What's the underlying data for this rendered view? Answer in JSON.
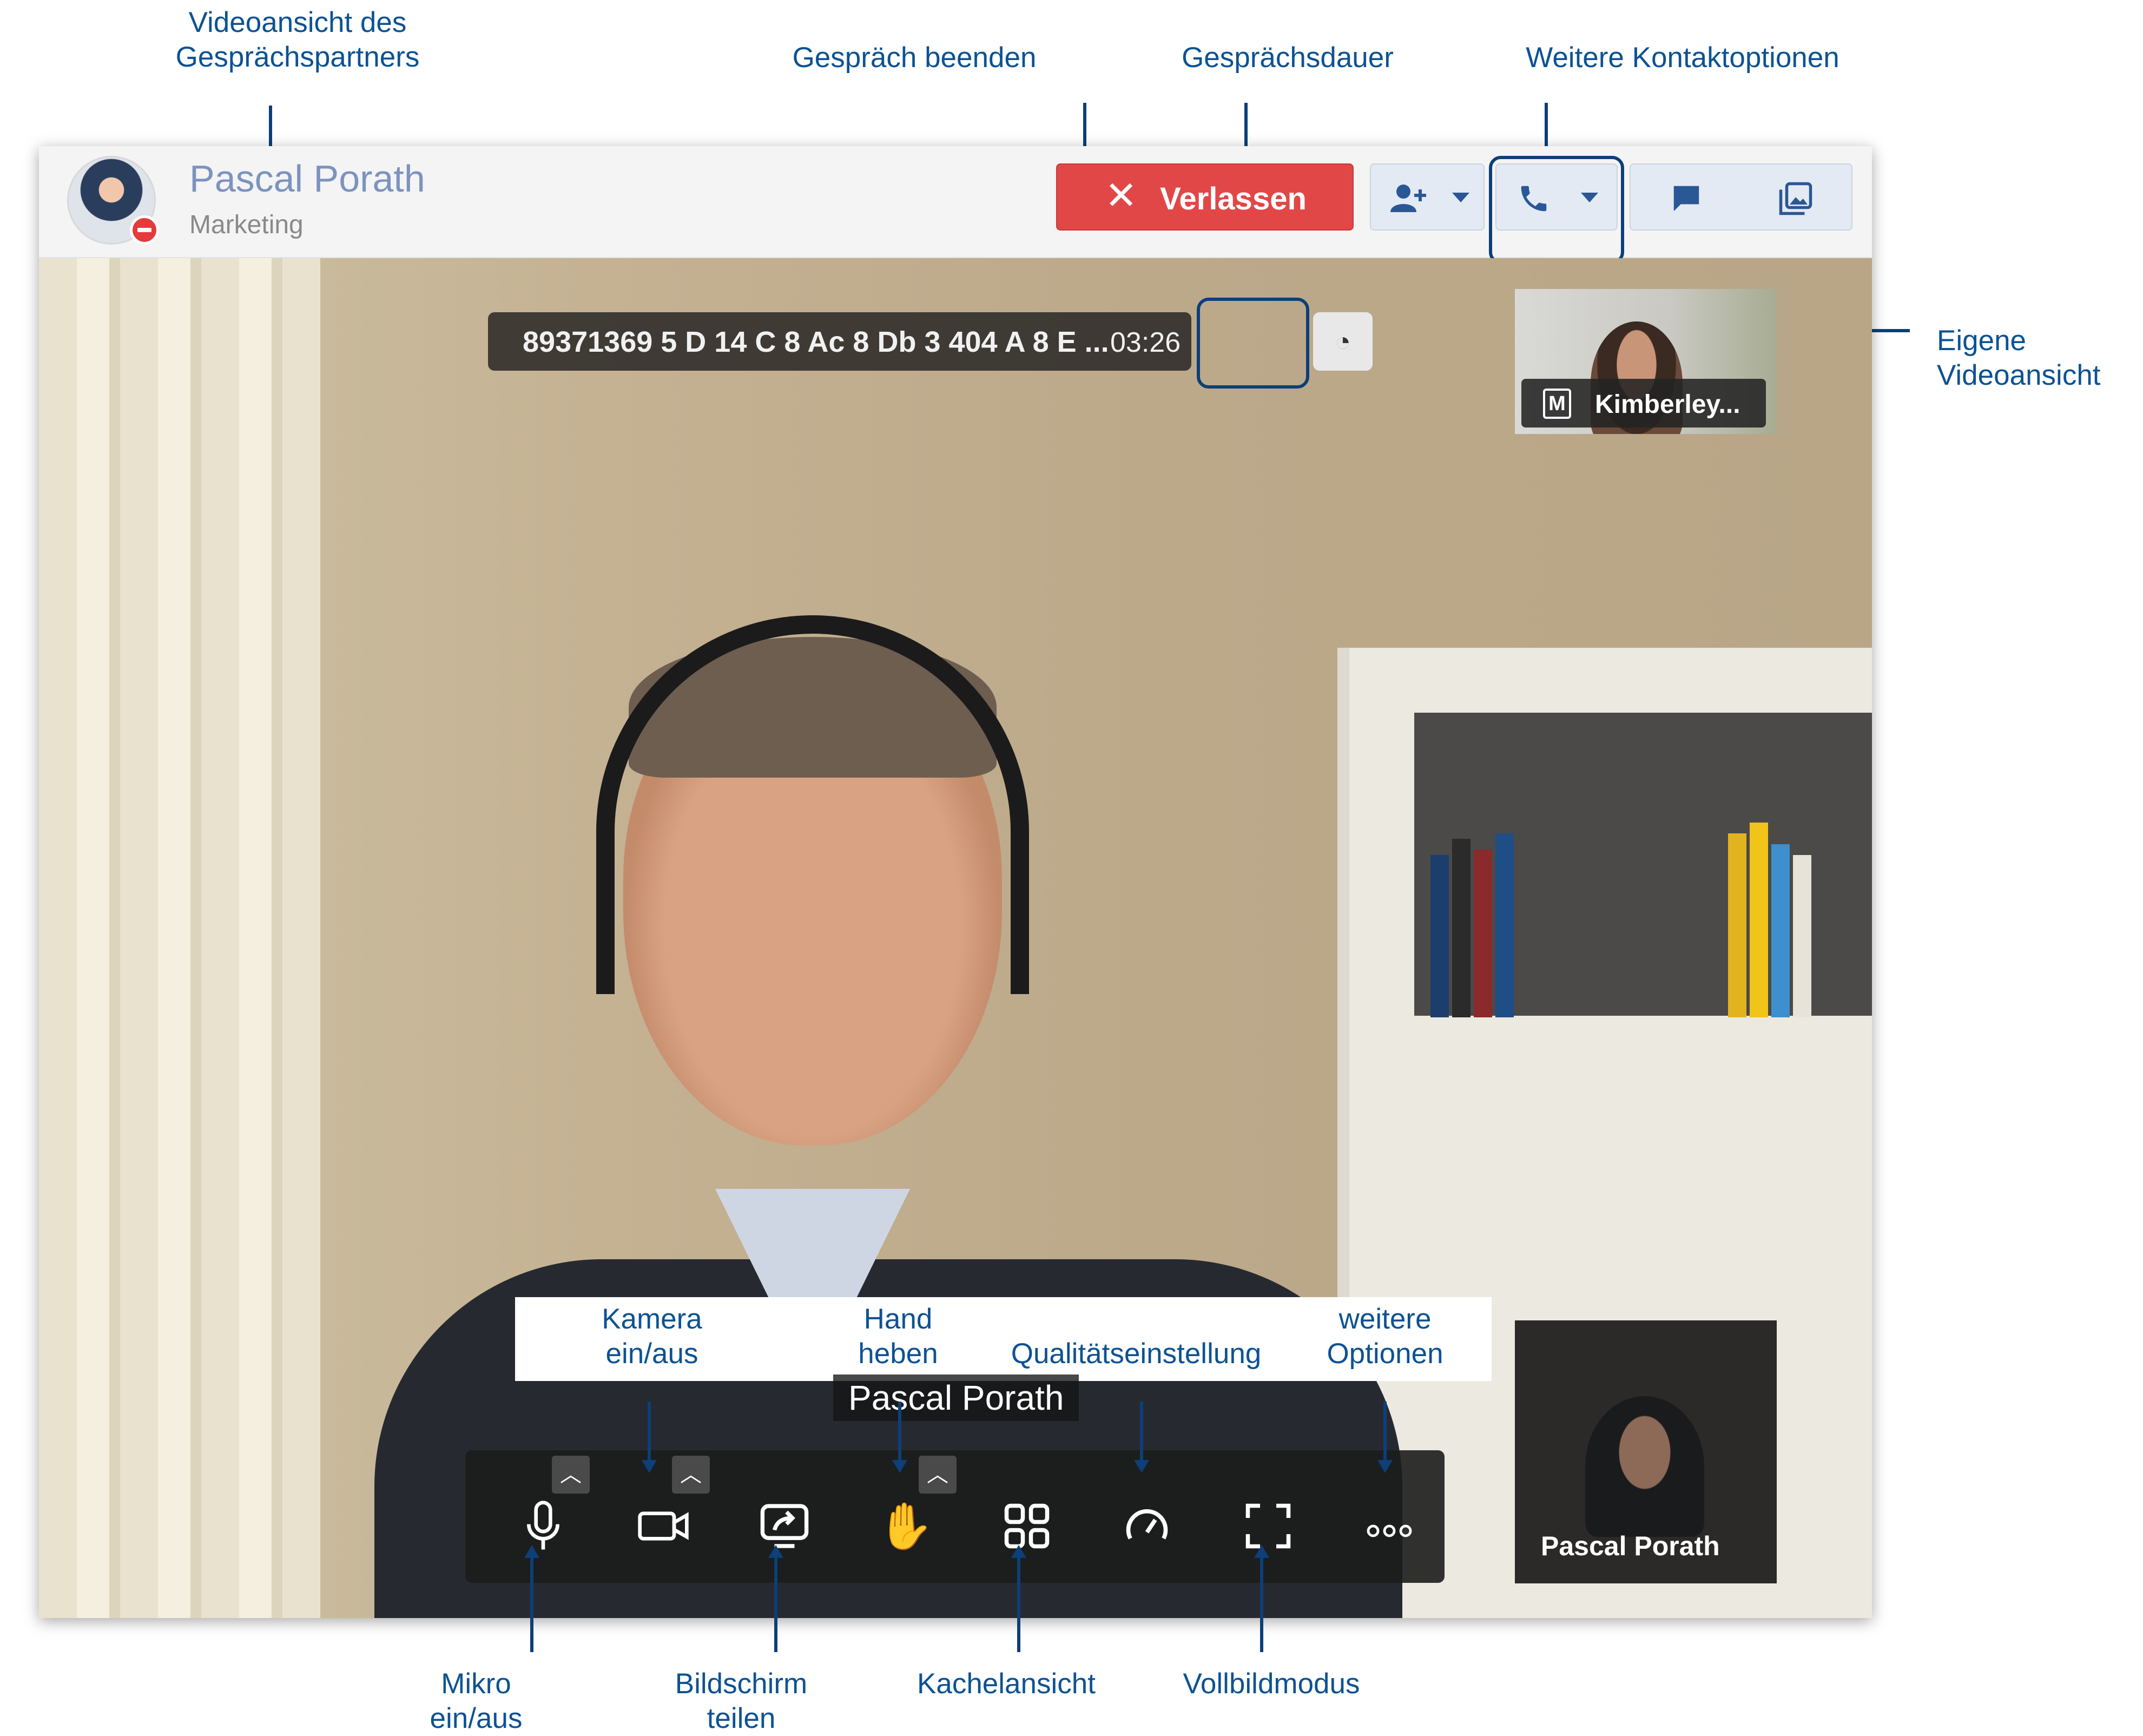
{
  "annotations": {
    "partner_video": "Videoansicht des\nGesprächspartners",
    "end_call": "Gespräch beenden",
    "call_duration": "Gesprächsdauer",
    "more_contact": "Weitere Kontaktoptionen",
    "own_video": "Eigene\nVideoansicht",
    "camera": "Kamera\nein/aus",
    "hand": "Hand\nheben",
    "quality": "Qualitätseinstellung",
    "more_options": "weitere\nOptionen",
    "mic": "Mikro\nein/aus",
    "screen_share": "Bildschirm\nteilen",
    "tile_view": "Kachelansicht",
    "fullscreen": "Vollbildmodus"
  },
  "header": {
    "contact_name": "Pascal Porath",
    "contact_department": "Marketing",
    "leave_label": "Verlassen",
    "leave_icon": "✕"
  },
  "toolbar_icons": {
    "add_person": "add-person-icon",
    "call": "phone-icon",
    "chat": "chat-icon",
    "media": "gallery-icon"
  },
  "call": {
    "call_id": "89371369 5 D 14 C 8 Ac 8 Db 3 404 A 8 E ...",
    "duration": "03:26"
  },
  "self_view": {
    "badge": "M",
    "name": "Kimberley..."
  },
  "thumbnail": {
    "name": "Pascal Porath"
  },
  "speaker": {
    "name": "Pascal Porath"
  },
  "colors": {
    "accent": "#0d3f78",
    "leave_red": "#e14747",
    "annotation_blue": "#0d5293"
  }
}
